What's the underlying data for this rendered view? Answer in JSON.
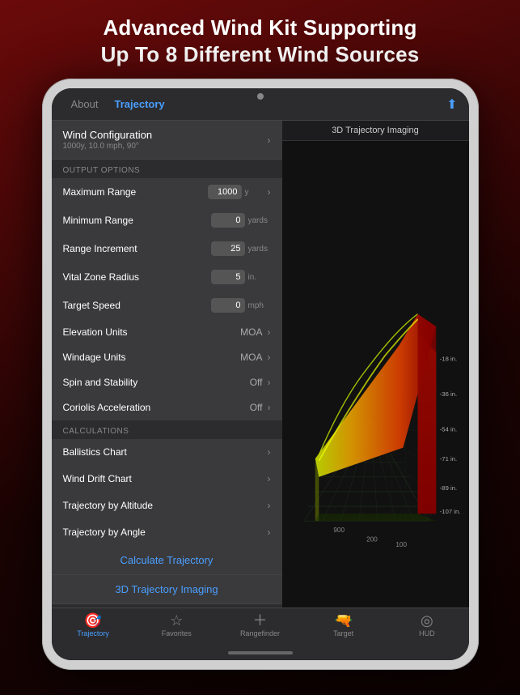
{
  "header": {
    "line1": "Advanced Wind Kit Supporting",
    "line2": "Up To 8 Different Wind Sources"
  },
  "nav": {
    "about_label": "About",
    "trajectory_label": "Trajectory",
    "share_icon": "⬆",
    "right_title": "3D Trajectory Imaging"
  },
  "wind_config": {
    "label": "Wind Configuration",
    "sub": "1000y, 10.0 mph, 90°"
  },
  "output_section": {
    "header": "OUTPUT OPTIONS",
    "rows": [
      {
        "label": "Maximum Range",
        "value": "1000",
        "unit": "y"
      },
      {
        "label": "Minimum Range",
        "value": "0",
        "unit": "yards"
      },
      {
        "label": "Range Increment",
        "value": "25",
        "unit": "yards"
      },
      {
        "label": "Vital Zone Radius",
        "value": "5",
        "unit": "in."
      },
      {
        "label": "Target Speed",
        "value": "0",
        "unit": "mph"
      }
    ],
    "selects": [
      {
        "label": "Elevation Units",
        "value": "MOA"
      },
      {
        "label": "Windage Units",
        "value": "MOA"
      },
      {
        "label": "Spin and Stability",
        "value": "Off"
      },
      {
        "label": "Coriolis Acceleration",
        "value": "Off"
      }
    ]
  },
  "calculations": {
    "header": "CALCULATIONS",
    "rows": [
      {
        "label": "Ballistics Chart"
      },
      {
        "label": "Wind Drift Chart"
      },
      {
        "label": "Trajectory by Altitude"
      },
      {
        "label": "Trajectory by Angle"
      }
    ]
  },
  "actions": [
    {
      "label": "Calculate Trajectory"
    },
    {
      "label": "3D Trajectory Imaging"
    }
  ],
  "tabs": [
    {
      "icon": "🎯",
      "label": "Trajectory",
      "active": true
    },
    {
      "icon": "☆",
      "label": "Favorites",
      "active": false
    },
    {
      "icon": "+",
      "label": "Rangefinder",
      "active": false
    },
    {
      "icon": "🔫",
      "label": "Target",
      "active": false
    },
    {
      "icon": "◎",
      "label": "HUD",
      "active": false
    }
  ],
  "chart_labels": [
    "-18 in.",
    "-36 in.",
    "-54 in.",
    "-71 in.",
    "-89 in.",
    "-107 in."
  ],
  "chart_distances": [
    "900",
    "200",
    "100"
  ]
}
